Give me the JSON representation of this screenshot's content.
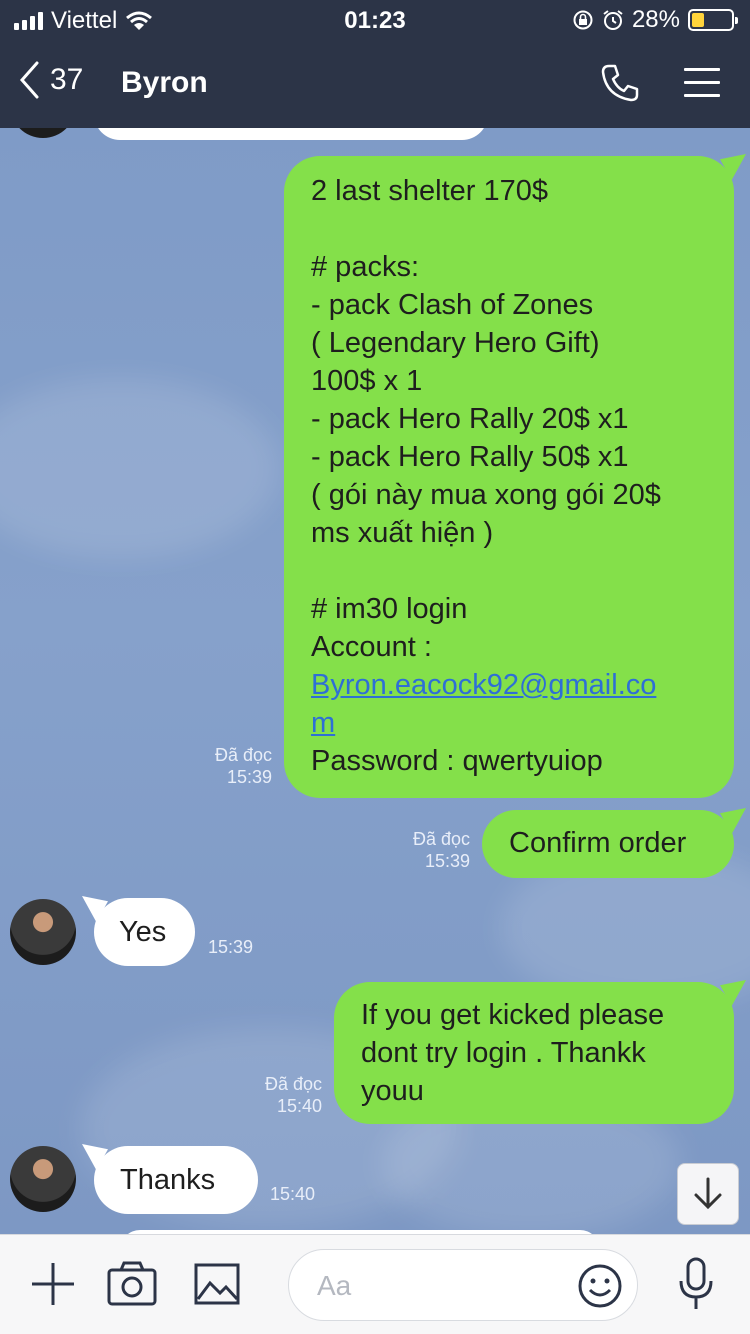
{
  "status_bar": {
    "carrier": "Viettel",
    "time": "01:23",
    "battery": "28%",
    "battery_fraction": 0.28
  },
  "nav": {
    "back_count": "37",
    "title": "Byron"
  },
  "messages": {
    "m1": {
      "lines": [
        "2  last shelter 170$",
        "",
        "# packs:",
        "- pack Clash of Zones",
        "( Legendary Hero Gift)",
        "100$ x 1",
        "- pack Hero Rally 20$ x1",
        "- pack Hero Rally 50$ x1",
        "( gói này mua xong gói 20$",
        "ms xuất hiện )",
        "",
        "# im30 login",
        "Account :"
      ],
      "email_line1": "Byron.eacock92@gmail.co",
      "email_line2": "m",
      "password_line": "Password : qwertyuiop",
      "read": "Đã đọc",
      "time": "15:39"
    },
    "m2": {
      "text": "Confirm order",
      "read": "Đã đọc",
      "time": "15:39"
    },
    "m3": {
      "text": "Yes",
      "time": "15:39"
    },
    "m4": {
      "lines": [
        "If you get kicked please",
        "dont try login . Thankk",
        "youu"
      ],
      "read": "Đã đọc",
      "time": "15:40"
    },
    "m5": {
      "text": "Thanks",
      "time": "15:40"
    }
  },
  "input": {
    "placeholder": "Aa"
  },
  "icons": [
    "wifi-icon",
    "alarm-icon",
    "rotation-lock-icon",
    "phone-icon",
    "menu-icon",
    "plus-icon",
    "camera-icon",
    "image-icon",
    "smiley-icon",
    "microphone-icon",
    "arrow-down-icon"
  ]
}
